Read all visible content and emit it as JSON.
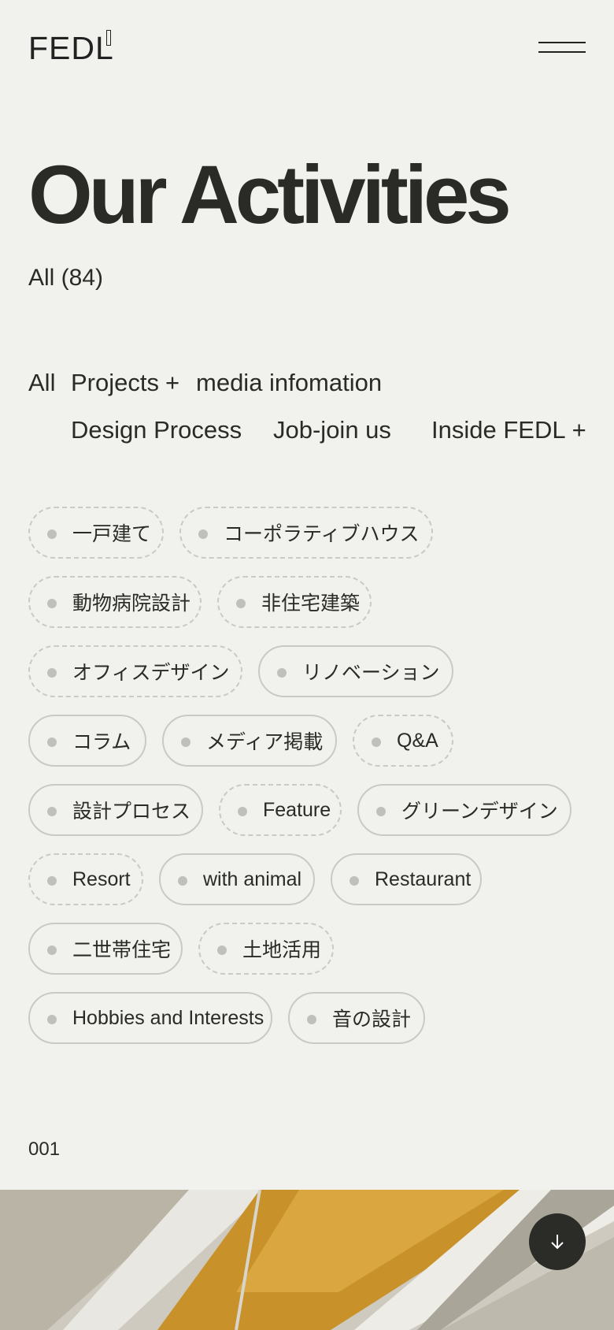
{
  "header": {
    "logo": "FEDL",
    "menu_icon": "hamburger-icon"
  },
  "page": {
    "title": "Our Activities",
    "count_label": "All (84)"
  },
  "nav": {
    "all": "All",
    "projects": "Projects",
    "media": "media infomation",
    "design_process": "Design Process",
    "job": "Job-join us",
    "inside": "Inside FEDL",
    "plus": "+"
  },
  "tags": [
    "一戸建て",
    "コーポラティブハウス",
    "動物病院設計",
    "非住宅建築",
    "オフィスデザイン",
    "リノベーション",
    "コラム",
    "メディア掲載",
    "Q&A",
    "設計プロセス",
    "Feature",
    "グリーンデザイン",
    "Resort",
    "with animal",
    "Restaurant",
    "二世帯住宅",
    "土地活用",
    "Hobbies and Interests",
    "音の設計"
  ],
  "sequence": "001",
  "scroll_icon": "arrow-down-icon",
  "colors": {
    "background": "#f1f1ee",
    "text": "#2a2a26",
    "chip_border": "#c9c9c5",
    "chip_dot": "#bfbfbb",
    "fab": "#2b2b28"
  }
}
